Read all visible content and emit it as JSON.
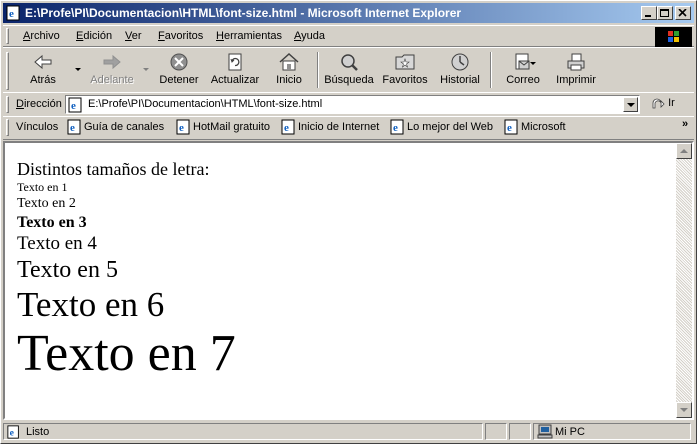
{
  "window": {
    "title": "E:\\Profe\\PI\\Documentacion\\HTML\\font-size.html - Microsoft Internet Explorer"
  },
  "menu": {
    "items": [
      "Archivo",
      "Edición",
      "Ver",
      "Favoritos",
      "Herramientas",
      "Ayuda"
    ]
  },
  "toolbar": {
    "back": "Atrás",
    "forward": "Adelante",
    "stop": "Detener",
    "refresh": "Actualizar",
    "home": "Inicio",
    "search": "Búsqueda",
    "favorites": "Favoritos",
    "history": "Historial",
    "mail": "Correo",
    "print": "Imprimir"
  },
  "address": {
    "label": "Dirección",
    "value": "E:\\Profe\\PI\\Documentacion\\HTML\\font-size.html",
    "go": "Ir"
  },
  "links": {
    "label": "Vínculos",
    "items": [
      "Guía de canales",
      "HotMail gratuito",
      "Inicio de Internet",
      "Lo mejor del Web",
      "Microsoft"
    ],
    "more": "»"
  },
  "content": {
    "heading": "Distintos tamaños de letra:",
    "lines": [
      "Texto en 1",
      "Texto en 2",
      "Texto en 3",
      "Texto en 4",
      "Texto en 5",
      "Texto en 6",
      "Texto en 7"
    ]
  },
  "status": {
    "text": "Listo",
    "zone": "Mi PC"
  },
  "colors": {
    "titlebar_start": "#0a246a",
    "titlebar_end": "#a6caf0",
    "chrome": "#d4d0c8"
  }
}
